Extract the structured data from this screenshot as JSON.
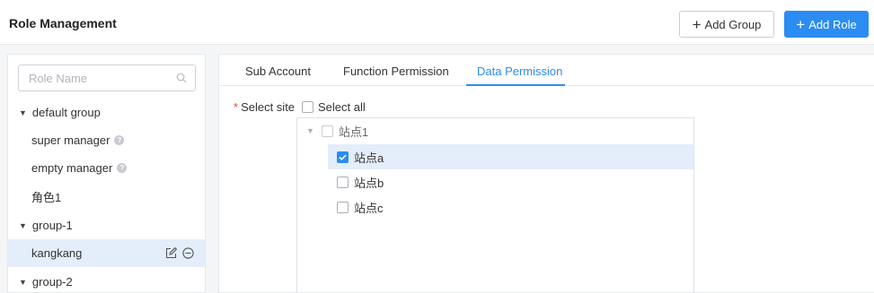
{
  "header": {
    "title": "Role Management",
    "add_group_label": "Add Group",
    "add_role_label": "Add Role"
  },
  "sidebar": {
    "search_placeholder": "Role Name",
    "items": [
      {
        "label": "default group",
        "kind": "group"
      },
      {
        "label": "super manager",
        "kind": "role",
        "help": true
      },
      {
        "label": "empty manager",
        "kind": "role",
        "help": true
      },
      {
        "label": "角色1",
        "kind": "role"
      },
      {
        "label": "group-1",
        "kind": "group"
      },
      {
        "label": "kangkang",
        "kind": "role",
        "selected": true
      },
      {
        "label": "group-2",
        "kind": "group"
      }
    ]
  },
  "tabs": [
    {
      "label": "Sub Account",
      "active": false
    },
    {
      "label": "Function Permission",
      "active": false
    },
    {
      "label": "Data Permission",
      "active": true
    }
  ],
  "data_permission": {
    "select_site_label": "Select site",
    "select_all_label": "Select all",
    "sites": {
      "parent": "站点1",
      "children": [
        {
          "label": "站点a",
          "checked": true
        },
        {
          "label": "站点b",
          "checked": false
        },
        {
          "label": "站点c",
          "checked": false
        }
      ]
    }
  },
  "colors": {
    "accent": "#2b8cf2",
    "selected_bg": "#e4eefb",
    "required": "#f0443a"
  }
}
